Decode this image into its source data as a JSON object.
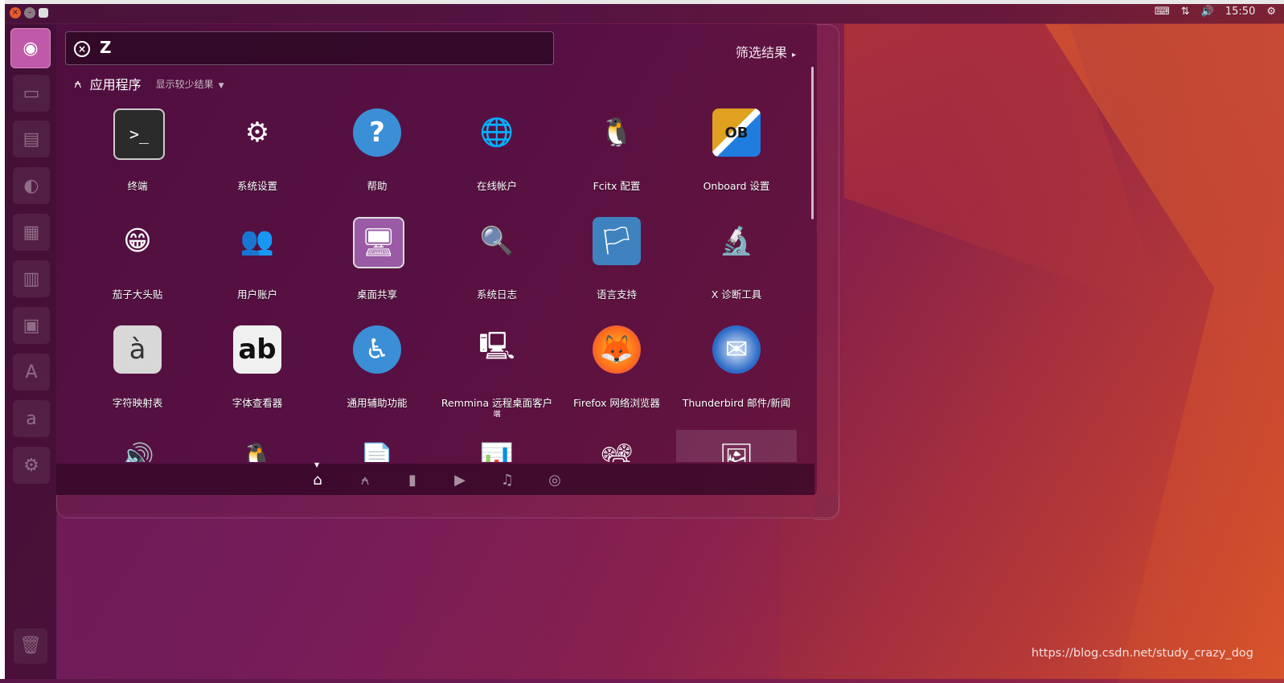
{
  "panel": {
    "clock": "15:50"
  },
  "search": {
    "query": "Z"
  },
  "filter_label": "筛选结果",
  "section": {
    "title": "应用程序",
    "toggle": "显示较少结果"
  },
  "apps": [
    {
      "label": "终端",
      "icon": "terminal-icon",
      "glyph": ">_"
    },
    {
      "label": "系统设置",
      "icon": "system-settings-icon",
      "glyph": "⚙"
    },
    {
      "label": "帮助",
      "icon": "help-icon",
      "glyph": "?"
    },
    {
      "label": "在线帐户",
      "icon": "online-accounts-icon",
      "glyph": "🌐"
    },
    {
      "label": "Fcitx 配置",
      "icon": "fcitx-config-icon",
      "glyph": "🐧"
    },
    {
      "label": "Onboard 设置",
      "icon": "onboard-settings-icon",
      "glyph": "OB"
    },
    {
      "label": "茄子大头贴",
      "icon": "cheese-icon",
      "glyph": "😁"
    },
    {
      "label": "用户账户",
      "icon": "user-accounts-icon",
      "glyph": "👥"
    },
    {
      "label": "桌面共享",
      "icon": "desktop-sharing-icon",
      "glyph": "🖥"
    },
    {
      "label": "系统日志",
      "icon": "system-log-icon",
      "glyph": "🔍"
    },
    {
      "label": "语言支持",
      "icon": "language-support-icon",
      "glyph": "🏳"
    },
    {
      "label": "X 诊断工具",
      "icon": "x-diagnostic-icon",
      "glyph": "🔬"
    },
    {
      "label": "字符映射表",
      "icon": "character-map-icon",
      "glyph": "à"
    },
    {
      "label": "字体查看器",
      "icon": "font-viewer-icon",
      "glyph": "ab"
    },
    {
      "label": "通用辅助功能",
      "icon": "accessibility-icon",
      "glyph": "♿"
    },
    {
      "label": "Remmina 远程桌面客户",
      "sub": "端",
      "icon": "remmina-icon",
      "glyph": "🖳"
    },
    {
      "label": "Firefox 网络浏览器",
      "icon": "firefox-icon",
      "glyph": "🦊"
    },
    {
      "label": "Thunderbird 邮件/新闻",
      "icon": "thunderbird-icon",
      "glyph": "✉"
    },
    {
      "label": "",
      "icon": "rhythmbox-icon",
      "glyph": "🔊"
    },
    {
      "label": "",
      "icon": "fcitx-icon",
      "glyph": "🐧"
    },
    {
      "label": "",
      "icon": "libreoffice-icon",
      "glyph": "📄"
    },
    {
      "label": "",
      "icon": "libreoffice-calc-icon",
      "glyph": "📊"
    },
    {
      "label": "",
      "icon": "libreoffice-impress-icon",
      "glyph": "📽"
    },
    {
      "label": "",
      "icon": "libreoffice-draw-icon",
      "glyph": "🖼"
    }
  ],
  "watermark": "https://blog.csdn.net/study_crazy_dog",
  "colors": {
    "launcher_home": "#c05aa8",
    "firefox": "#ff6d1a",
    "help": "#3a8fd6"
  }
}
